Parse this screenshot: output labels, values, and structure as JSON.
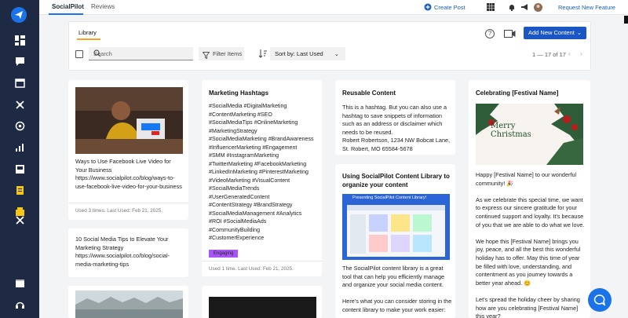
{
  "topbar": {
    "tabs": [
      {
        "label": "SocialPilot"
      },
      {
        "label": "Reviews"
      }
    ],
    "create_post": "Create Post",
    "request_feature": "Request New Feature"
  },
  "sidebar": {
    "icons": [
      "send-icon",
      "dashboard-icon",
      "messages-icon",
      "calendar-icon",
      "connect-icon",
      "target-icon",
      "analytics-icon",
      "inbox-icon",
      "reports-icon",
      "library-icon",
      "tools-icon",
      "calendar-bottom-icon",
      "support-icon"
    ]
  },
  "toolbar": {
    "library_tab": "Library",
    "add_new": "Add New Content",
    "search_placeholder": "Search",
    "filter": "Filter Items",
    "sort": "Sort by: Last Used",
    "count": "1 — 17 of 17"
  },
  "cards": {
    "c1": {
      "text": "Ways to Use Facebook Live Video for Your Business\nhttps://www.socialpilot.co/blog/ways-to-use-facebook-live-video-for-your-business",
      "meta": "Used 3 times. Last Used: Feb 21, 2025."
    },
    "c1b": {
      "text": "10 Social Media Tips to Elevate Your Marketing Strategy\nhttps://www.socialpilot.co/blog/social-media-marketing-tips"
    },
    "c2": {
      "title": "Marketing Hashtags",
      "text": "#SocialMedia #DigitalMarketing\n#ContentMarketing #SEO\n#SocialMediaTips #OnlineMarketing\n#MarketingStrategy\n#SocialMediaMarketing #BrandAwareness\n#InfluencerMarketing #Engagement\n#SMM #InstagramMarketing\n#TwitterMarketing #FacebookMarketing\n#LinkedInMarketing #PinterestMarketing\n#VideoMarketing #VisualContent\n#SocialMediaTrends\n#UserGeneratedContent\n#ContentStrategy #BrandStrategy\n#SocialMediaManagement #Analytics\n#ROI #SocialMediaAds\n#CommunityBuilding\n#CustomerExperience",
      "badge": "Engaging",
      "meta": "Used 1 time. Last Used: Feb 21, 2025."
    },
    "c3": {
      "title": "Reusable Content",
      "text": "This is a hashtag. But you can also use a hashtag to save snippets of information such as an address or disclaimer which needs to be reused.\nRobert Robertson, 1234 NW Bobcat Lane, St. Robert, MO 65584-5678"
    },
    "c3b": {
      "title": "Using SocialPilot Content Library to organize your content",
      "text": "The SocialPilot content library is a great tool that can help you efficiently manage and organize your social media content.\n\nHere's what you can consider storing in the content library to make your work easier:",
      "shot_title": "Presenting SocialPilot Content Library!"
    },
    "c4": {
      "title": "Celebrating [Festival Name]",
      "image_text": "Merry Christmas",
      "text": "Happy [Festival Name] to our wonderful community! 🎉\n\nAs we celebrate this special time, we want to express our sincere gratitude for your continued support and loyalty. It's because of you that we are able to do what we love.\n\nWe hope this [Festival Name] brings you joy, peace, and all the best this wonderful holiday has to offer. May this time of year be filled with love, understanding, and contentment as you journey towards a better year ahead. 😊\n\nLet's spread the holiday cheer by sharing how are you celebrating [Festival Name] this year?"
    }
  },
  "colors": {
    "sidebar": "#1e2a44",
    "accent": "#1a73e8",
    "primary_button": "#1a56c4",
    "tab_underline": "#f5a524",
    "badge": "#a855f7"
  }
}
